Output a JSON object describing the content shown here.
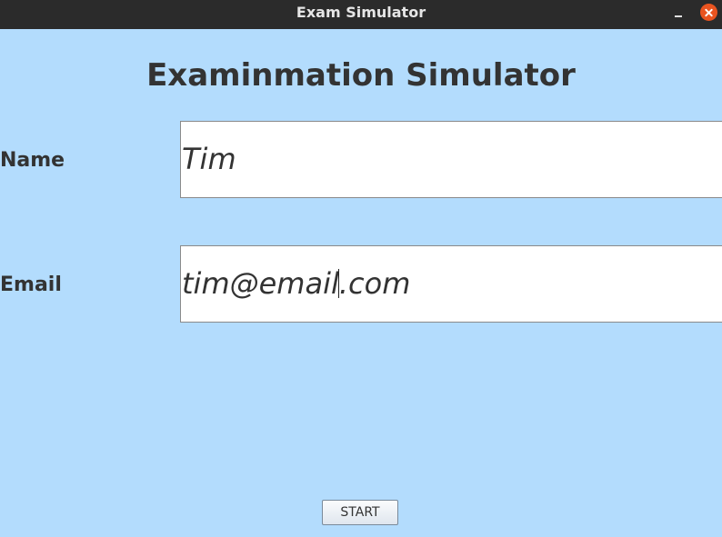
{
  "window": {
    "title": "Exam Simulator"
  },
  "form": {
    "heading": "Examinmation Simulator",
    "name_label": "Name",
    "name_value": "Tim",
    "email_label": "Email",
    "email_value_before_caret": "tim@email",
    "email_value_after_caret": ".com",
    "start_label": "START"
  },
  "colors": {
    "background": "#b3dcfd",
    "titlebar": "#2b2b2b",
    "close_button": "#e95420",
    "text": "#333333"
  }
}
